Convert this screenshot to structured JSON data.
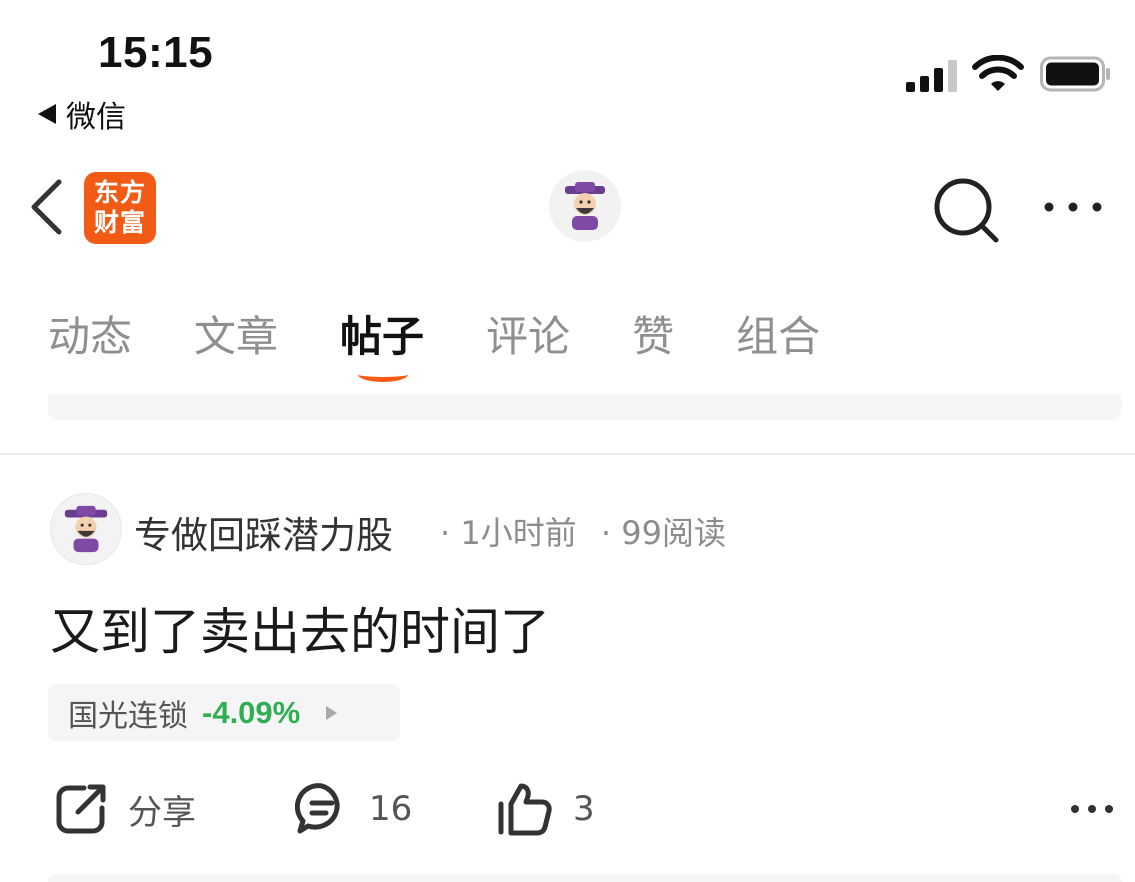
{
  "status_bar": {
    "time": "15:15",
    "back_label": "微信",
    "icons": [
      "signal-icon",
      "wifi-icon",
      "battery-icon"
    ]
  },
  "header": {
    "logo_line1": "东方",
    "logo_line2": "财富",
    "brand_color": "#f25b15"
  },
  "tabs": [
    {
      "label": "动态",
      "active": false
    },
    {
      "label": "文章",
      "active": false
    },
    {
      "label": "帖子",
      "active": true
    },
    {
      "label": "评论",
      "active": false
    },
    {
      "label": "赞",
      "active": false
    },
    {
      "label": "组合",
      "active": false
    }
  ],
  "post": {
    "author": "专做回踩潜力股",
    "time_ago": "· 1小时前",
    "reads": "· 99阅读",
    "content": "又到了卖出去的时间了",
    "stock": {
      "name": "国光连锁",
      "change": "-4.09%",
      "change_color": "#2fae53"
    },
    "actions": {
      "share_label": "分享",
      "comments": "16",
      "likes": "3"
    }
  }
}
